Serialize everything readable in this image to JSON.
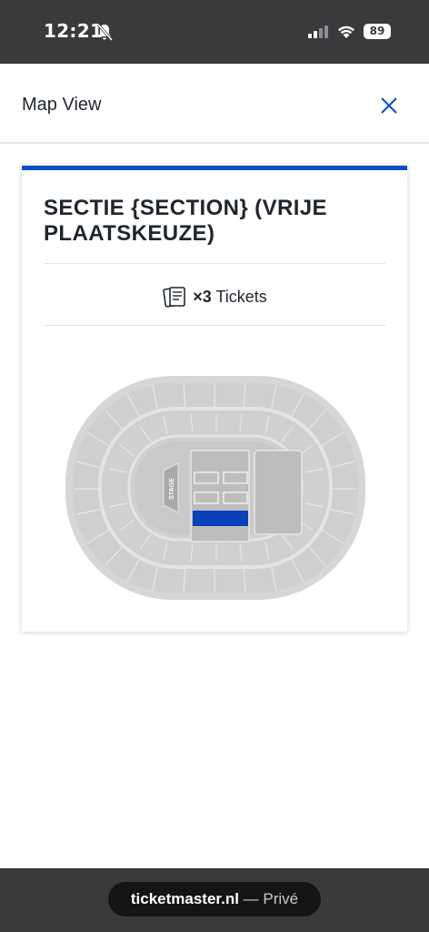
{
  "status_bar": {
    "time": "12:21",
    "battery": "89",
    "icons": [
      "bell-slash-icon",
      "cellular-signal-icon",
      "wifi-icon",
      "battery-icon"
    ]
  },
  "header": {
    "title": "Map View",
    "close_icon": "close-icon"
  },
  "card": {
    "accent_color": "#0e4fbf",
    "section_title": "SECTIE {SECTION} (VRIJE PLAATSKEUZE)",
    "tickets_icon": "tickets-icon",
    "tickets_count": "×3",
    "tickets_label": "Tickets"
  },
  "map": {
    "stage_label": "STAGE",
    "highlight_color": "#0a40b8"
  },
  "browser_bar": {
    "domain": "ticketmaster.nl",
    "separator": " — ",
    "mode": "Privé"
  }
}
